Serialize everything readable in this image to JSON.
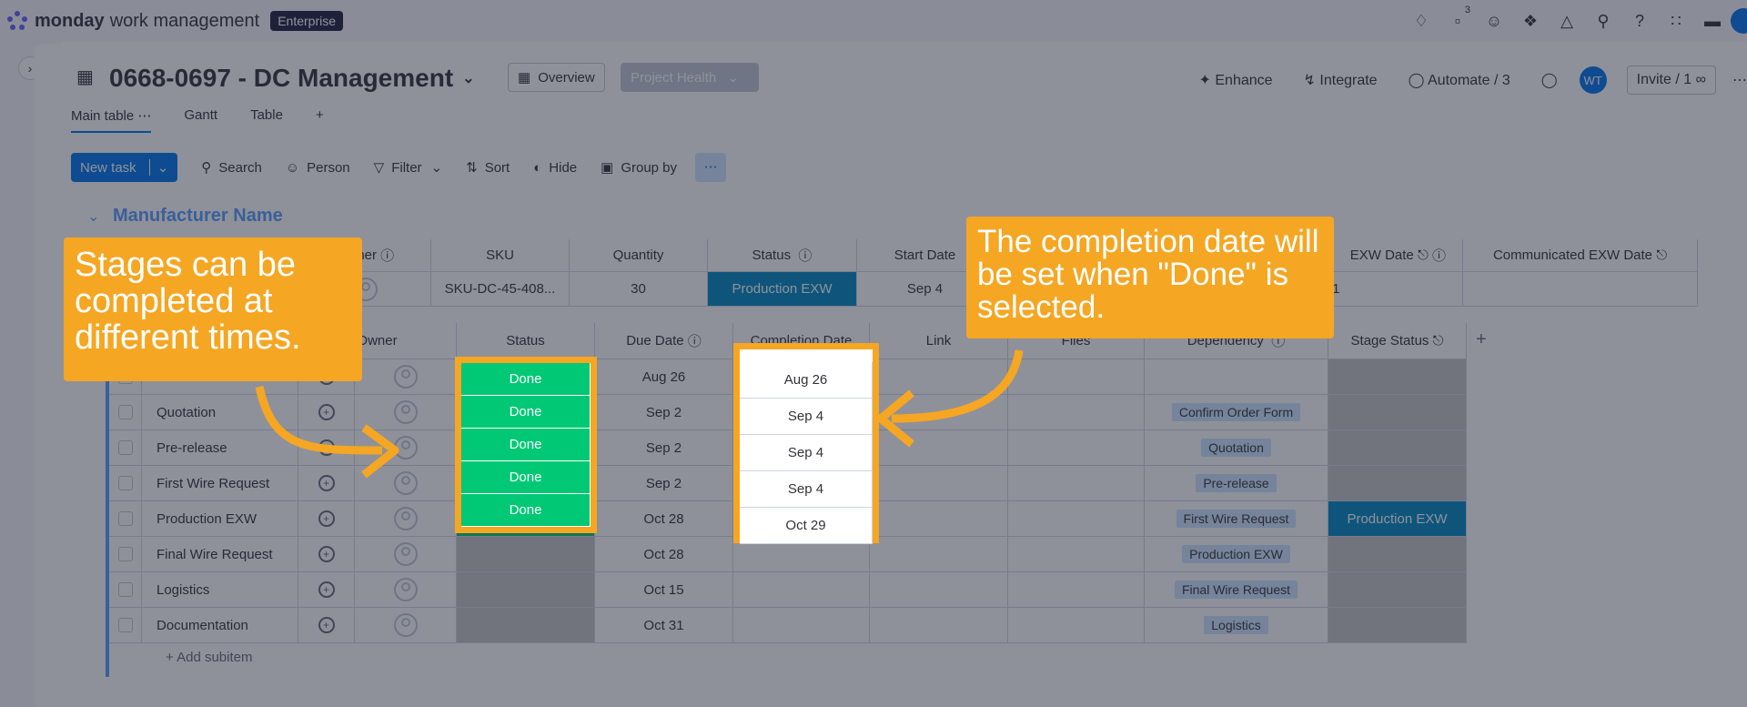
{
  "app": {
    "brand": "monday",
    "brand_sub": "work management",
    "plan": "Enterprise",
    "notif_count": "3"
  },
  "board": {
    "title": "0668-0697 - DC Management",
    "overview_label": "Overview",
    "health_label": "Project Health"
  },
  "actions": {
    "enhance": "Enhance",
    "integrate": "Integrate",
    "automate": "Automate / 3",
    "avatar": "WT",
    "invite": "Invite / 1"
  },
  "tabs": [
    "Main table",
    "Gantt",
    "Table"
  ],
  "toolbar": {
    "new_task": "New task",
    "search": "Search",
    "person": "Person",
    "filter": "Filter",
    "sort": "Sort",
    "hide": "Hide",
    "group_by": "Group by"
  },
  "group": {
    "name": "Manufacturer Name"
  },
  "parent_headers": [
    "Owner",
    "SKU",
    "Quantity",
    "Status",
    "Start Date",
    "EXW Date",
    "Communicated EXW Date"
  ],
  "parent_row": {
    "sku": "SKU-DC-45-408...",
    "quantity": "30",
    "status": "Production EXW",
    "start_date": "Sep 4",
    "exw_date": "ct 31"
  },
  "sub_headers": [
    "Owner",
    "Status",
    "Due Date",
    "Completion Date",
    "Link",
    "Files",
    "Dependency",
    "Stage Status"
  ],
  "subitems": [
    {
      "name": "",
      "status": "Done",
      "due": "Aug 26",
      "completion": "Aug 26",
      "dependency": "",
      "stage": ""
    },
    {
      "name": "Quotation",
      "status": "Done",
      "due": "Sep 2",
      "completion": "Sep 4",
      "dependency": "Confirm Order Form",
      "stage": ""
    },
    {
      "name": "Pre-release",
      "status": "Done",
      "due": "Sep 2",
      "completion": "Sep 4",
      "dependency": "Quotation",
      "stage": ""
    },
    {
      "name": "First Wire Request",
      "status": "Done",
      "due": "Sep 2",
      "completion": "Sep 4",
      "dependency": "Pre-release",
      "stage": ""
    },
    {
      "name": "Production EXW",
      "status": "Done",
      "due": "Oct 28",
      "completion": "Oct 29",
      "dependency": "First Wire Request",
      "stage": "Production EXW"
    },
    {
      "name": "Final Wire Request",
      "status": "",
      "due": "Oct 28",
      "completion": "",
      "dependency": "Production EXW",
      "stage": ""
    },
    {
      "name": "Logistics",
      "status": "",
      "due": "Oct 15",
      "completion": "",
      "dependency": "Final Wire Request",
      "stage": ""
    },
    {
      "name": "Documentation",
      "status": "",
      "due": "Oct 31",
      "completion": "",
      "dependency": "Logistics",
      "stage": ""
    }
  ],
  "add_subitem": "+ Add subitem",
  "callouts": {
    "left": "Stages can be completed at different times.",
    "right": "The completion date will be set when \"Done\" is selected."
  },
  "colors": {
    "accent": "#0073ea",
    "done": "#00c875",
    "callout": "#f5a623",
    "production_exw": "#0086c0"
  }
}
